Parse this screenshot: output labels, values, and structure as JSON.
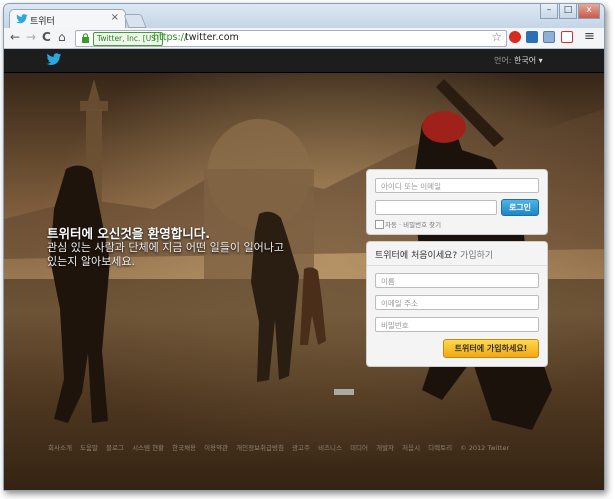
{
  "browser": {
    "tab_title": "트위터",
    "tab_close": "×",
    "window_buttons": {
      "minimize": "–",
      "maximize": "□",
      "close": "x"
    },
    "nav": {
      "back": "←",
      "forward": "→",
      "reload": "C",
      "home": "⌂"
    },
    "ev_badge": "Twitter, Inc. [US]",
    "url_scheme": "https://",
    "url_host": "twitter.com",
    "star": "☆",
    "menu": "≡"
  },
  "site": {
    "language_label": "언어:",
    "language_value": "한국어 ▾"
  },
  "welcome": {
    "title": "트위터에 오신것을 환영합니다.",
    "line1": "관심 있는 사람과 단체에 지금 어떤 일들이 일어나고",
    "line2": "있는지 알아보세요."
  },
  "login": {
    "id_placeholder": "아이디 또는 이메일",
    "password_placeholder": "",
    "button": "로그인",
    "remember": "자동 · 비밀번호 찾기"
  },
  "signup": {
    "heading": "트위터에 처음이세요?",
    "heading_link": "가입하기",
    "name_placeholder": "이름",
    "email_placeholder": "이메일 주소",
    "password_placeholder": "비밀번호",
    "button": "트위터에 가입하세요!"
  },
  "footer": {
    "links": [
      "회사소개",
      "도움말",
      "블로그",
      "시스템 현황",
      "한국채용",
      "이용약관",
      "개인정보취급방침",
      "광고주",
      "비즈니스",
      "미디어",
      "개발자",
      "처음시",
      "디렉토리",
      "© 2012 Twitter"
    ]
  },
  "colors": {
    "accent_blue": "#1e86c8",
    "join_yellow": "#f3a712",
    "https_green": "#2d8a1f"
  }
}
